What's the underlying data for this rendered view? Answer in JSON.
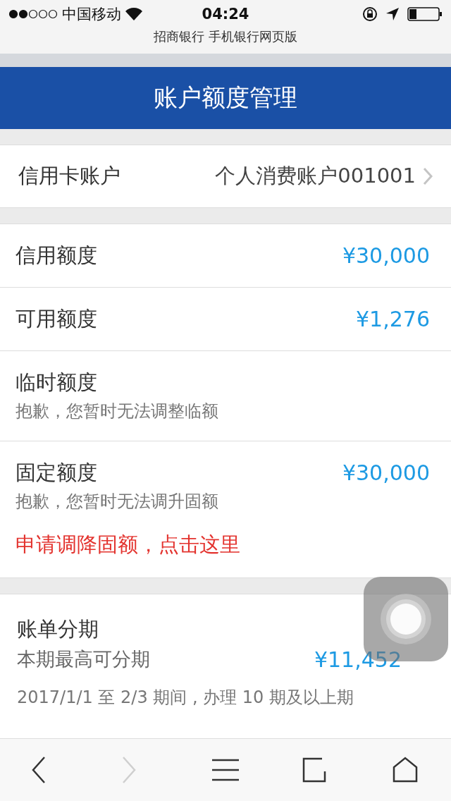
{
  "status_bar": {
    "carrier": "中国移动",
    "time": "04:24"
  },
  "url_bar": {
    "title": "招商银行 手机银行网页版"
  },
  "header": {
    "title": "账户额度管理"
  },
  "account_row": {
    "label": "信用卡账户",
    "value": "个人消费账户001001"
  },
  "limits": [
    {
      "label": "信用额度",
      "amount": "¥30,000"
    },
    {
      "label": "可用额度",
      "amount": "¥1,276"
    },
    {
      "label": "临时额度",
      "note": "抱歉，您暂时无法调整临额"
    },
    {
      "label": "固定额度",
      "amount": "¥30,000",
      "note": "抱歉，您暂时无法调升固额",
      "link": "申请调降固额，点击这里"
    }
  ],
  "installment": {
    "title": "账单分期",
    "label": "本期最高可分期",
    "amount": "¥11,452",
    "note": "2017/1/1 至 2/3 期间 , 办理 10 期及以上期"
  },
  "toolbar": [
    {
      "kind": "back",
      "disabled": false
    },
    {
      "kind": "forward",
      "disabled": true
    },
    {
      "kind": "menu",
      "disabled": false
    },
    {
      "kind": "tabs",
      "disabled": false
    },
    {
      "kind": "home",
      "disabled": false
    }
  ]
}
